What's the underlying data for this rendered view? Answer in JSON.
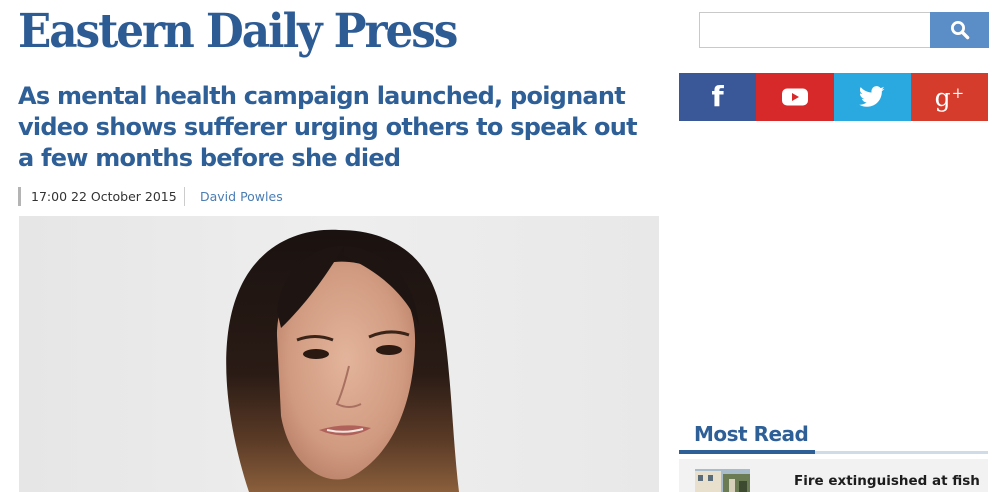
{
  "masthead": {
    "title": "Eastern Daily Press"
  },
  "search": {
    "placeholder": "",
    "value": "",
    "button_icon": "search-icon"
  },
  "social": [
    {
      "network": "facebook",
      "icon": "facebook-icon",
      "color": "#3a5898"
    },
    {
      "network": "youtube",
      "icon": "youtube-icon",
      "color": "#d7282a"
    },
    {
      "network": "twitter",
      "icon": "twitter-icon",
      "color": "#2aa8e0"
    },
    {
      "network": "google-plus",
      "icon": "google-plus-icon",
      "color": "#d63c2c"
    }
  ],
  "article": {
    "headline": "As mental health campaign launched, poignant video shows sufferer urging others to speak out a few months before she died",
    "timestamp": "17:00 22 October 2015",
    "author": "David Powles"
  },
  "most_read": {
    "heading": "Most Read",
    "items": [
      {
        "title": "Fire extinguished at fish"
      }
    ]
  },
  "colors": {
    "brand_blue": "#2d5b94",
    "headline_blue": "#2e5f97",
    "link_blue": "#4a7db4",
    "search_button": "#5b8dc7"
  }
}
